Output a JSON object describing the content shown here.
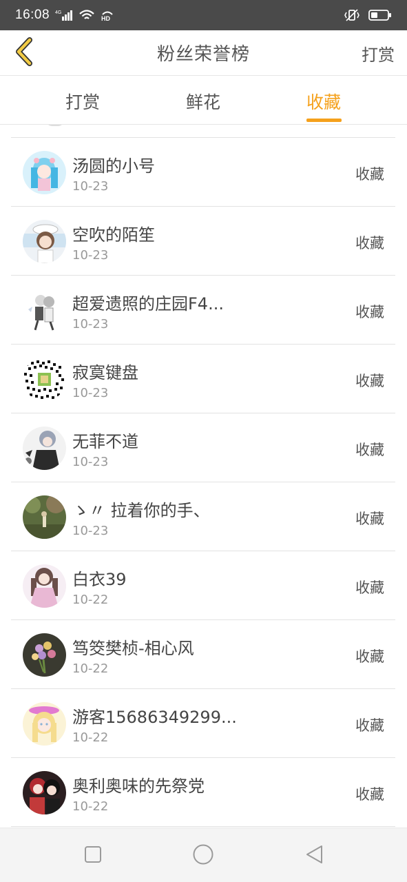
{
  "status_bar": {
    "time": "16:08",
    "network": "4G",
    "hd": "HD"
  },
  "header": {
    "title": "粉丝荣誉榜",
    "action": "打赏"
  },
  "tabs": [
    {
      "label": "打赏",
      "active": false
    },
    {
      "label": "鲜花",
      "active": false
    },
    {
      "label": "收藏",
      "active": true
    }
  ],
  "colors": {
    "accent": "#f5a11c",
    "status_bar": "#4a4a4a"
  },
  "fans": [
    {
      "name": "汤圆的小号",
      "date": "10-23",
      "action": "收藏"
    },
    {
      "name": "空吹的陌笙",
      "date": "10-23",
      "action": "收藏"
    },
    {
      "name": "超爱遗照的庄园F4...",
      "date": "10-23",
      "action": "收藏"
    },
    {
      "name": "寂寞键盘",
      "date": "10-23",
      "action": "收藏"
    },
    {
      "name": "无菲不道",
      "date": "10-23",
      "action": "收藏"
    },
    {
      "name": "ゝ〃 拉着你的手、",
      "date": "10-23",
      "action": "收藏"
    },
    {
      "name": "白衣39",
      "date": "10-22",
      "action": "收藏"
    },
    {
      "name": "笃筊樊桢-相心风",
      "date": "10-22",
      "action": "收藏"
    },
    {
      "name": "游客15686349299...",
      "date": "10-22",
      "action": "收藏"
    },
    {
      "name": "奥利奥味的先祭党",
      "date": "10-22",
      "action": "收藏"
    }
  ],
  "nav": {
    "icons": [
      "square-icon",
      "circle-icon",
      "triangle-back-icon"
    ]
  }
}
